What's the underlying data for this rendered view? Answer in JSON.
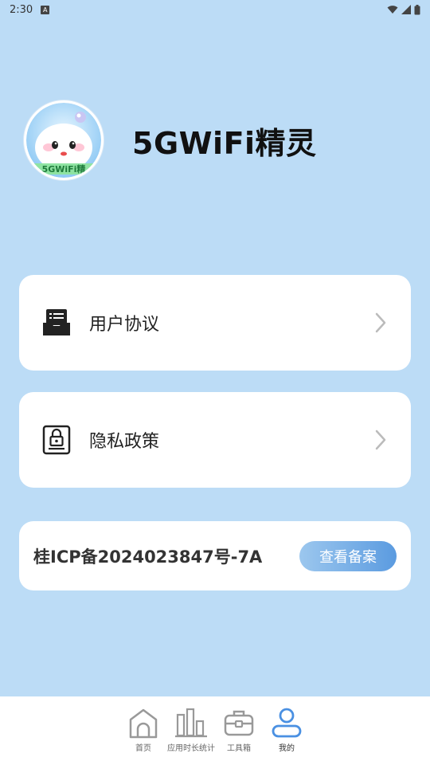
{
  "status_bar": {
    "time": "2:30",
    "notif": "A"
  },
  "app": {
    "name": "5GWiFi精灵",
    "avatar_caption": "5GWiFi精"
  },
  "menu": [
    {
      "label": "用户协议",
      "icon": "document-inbox-icon"
    },
    {
      "label": "隐私政策",
      "icon": "privacy-lock-icon"
    }
  ],
  "icp": {
    "text": "桂ICP备2024023847号-7A",
    "button": "查看备案"
  },
  "tabs": [
    {
      "label": "首页",
      "icon": "home-icon",
      "active": false
    },
    {
      "label": "应用时长统计",
      "icon": "bar-chart-icon",
      "active": false
    },
    {
      "label": "工具箱",
      "icon": "toolbox-icon",
      "active": false
    },
    {
      "label": "我的",
      "icon": "user-icon",
      "active": true
    }
  ],
  "colors": {
    "background": "#bcdcf6",
    "accent": "#4a90e2",
    "button_start": "#9cc7ee",
    "button_end": "#5b9be0"
  }
}
